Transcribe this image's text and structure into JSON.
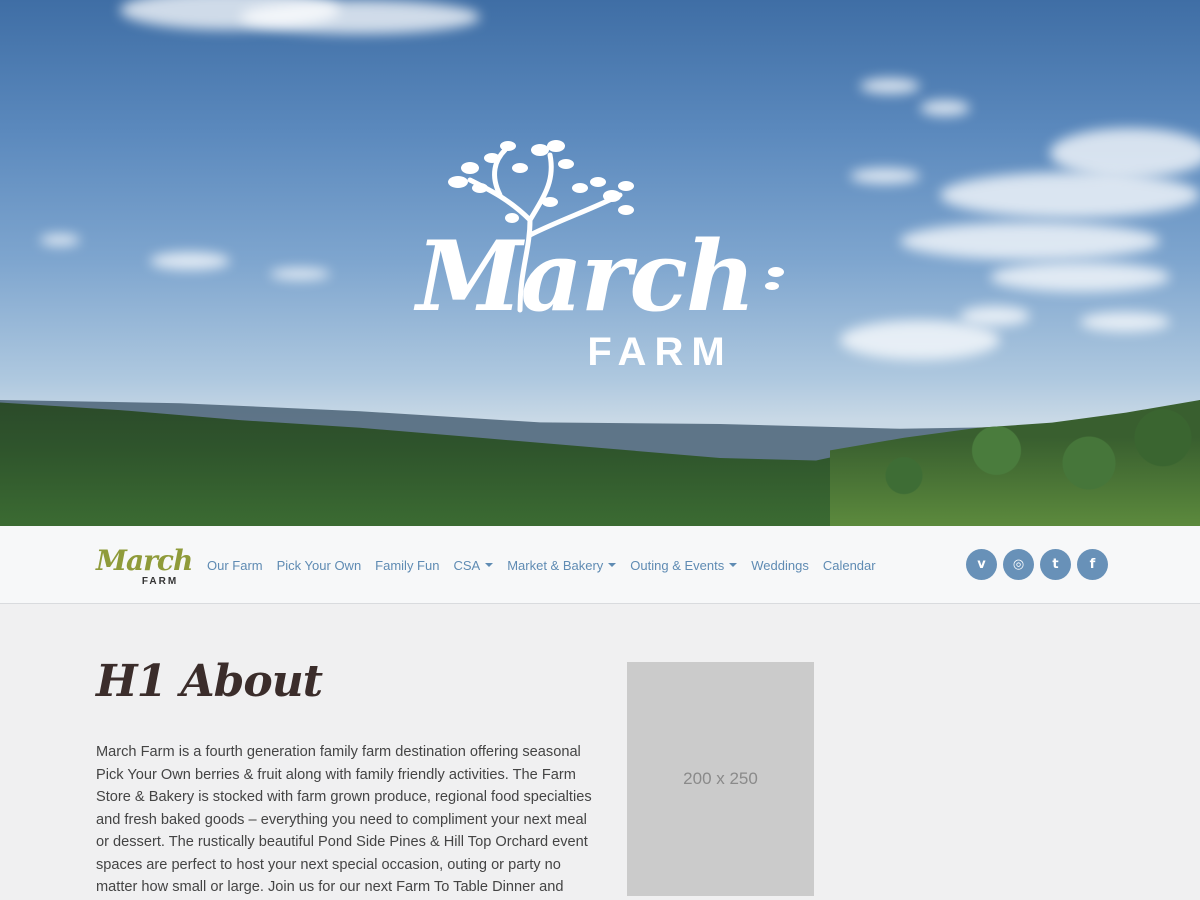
{
  "hero": {
    "brand_script": "March",
    "brand_sub": "FARM",
    "background": "sky-and-forest-landscape"
  },
  "navbar": {
    "logo_script": "March",
    "logo_sub": "FARM",
    "logo_color": "#8f9b3a",
    "link_color": "#5f8bb3",
    "links": [
      {
        "label": "Our Farm",
        "dropdown": false
      },
      {
        "label": "Pick Your Own",
        "dropdown": false
      },
      {
        "label": "Family Fun",
        "dropdown": false
      },
      {
        "label": "CSA",
        "dropdown": true
      },
      {
        "label": "Market & Bakery",
        "dropdown": true
      },
      {
        "label": "Outing & Events",
        "dropdown": true
      },
      {
        "label": "Weddings",
        "dropdown": false
      },
      {
        "label": "Calendar",
        "dropdown": false
      }
    ],
    "social": [
      {
        "name": "vimeo-icon",
        "glyph": "v"
      },
      {
        "name": "instagram-icon",
        "glyph": "◎"
      },
      {
        "name": "twitter-icon",
        "glyph": "t"
      },
      {
        "name": "facebook-icon",
        "glyph": "f"
      }
    ],
    "social_color": "#6891b8"
  },
  "main": {
    "heading": "H1 About",
    "paragraph": "March Farm is a fourth generation family farm destination offering seasonal Pick Your Own berries & fruit along with family friendly activities. The Farm Store & Bakery is stocked with farm grown produce, regional food specialties and fresh baked goods – everything you need to compliment your next meal or dessert. The rustically beautiful Pond Side Pines & Hill Top Orchard event spaces are perfect to host your next special occasion, outing or party no matter how small or large. Join us for our next Farm To Table Dinner and other special",
    "placeholder_label": "200 x 250"
  }
}
